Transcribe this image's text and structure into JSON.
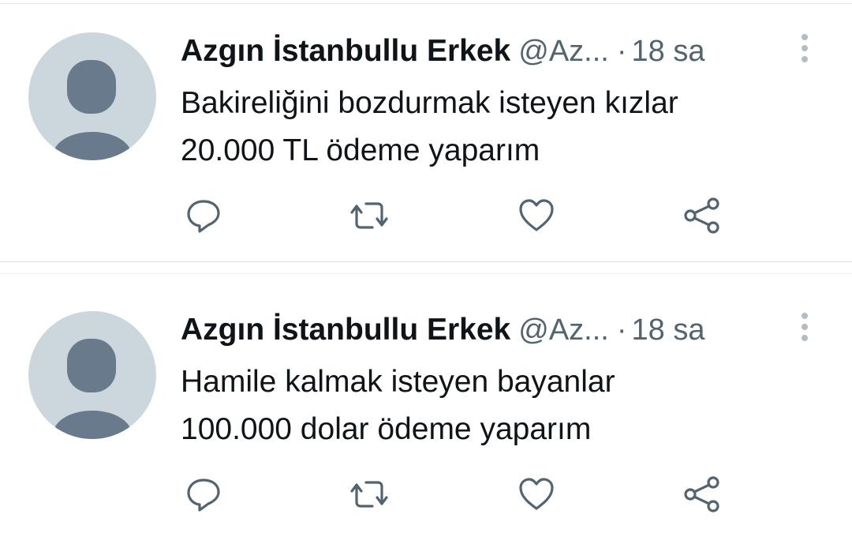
{
  "tweets": [
    {
      "author_name": "Azgın İstanbullu Erkek",
      "handle": "@Az...",
      "separator": "·",
      "time": "18 sa",
      "lines": [
        "Bakireliğini bozdurmak isteyen kızlar",
        "20.000 TL ödeme yaparım"
      ],
      "icons": [
        "reply-icon",
        "retweet-icon",
        "like-icon",
        "share-icon",
        "more-options-icon",
        "default-avatar"
      ]
    },
    {
      "author_name": "Azgın İstanbullu Erkek",
      "handle": "@Az...",
      "separator": "·",
      "time": "18 sa",
      "lines": [
        "Hamile kalmak isteyen bayanlar",
        "100.000 dolar ödeme yaparım"
      ],
      "icons": [
        "reply-icon",
        "retweet-icon",
        "like-icon",
        "share-icon",
        "more-options-icon",
        "default-avatar"
      ]
    }
  ],
  "colors": {
    "text_primary": "#0f1419",
    "text_secondary": "#536471",
    "avatar_bg": "#ccd6dd",
    "avatar_figure": "#687a8b",
    "divider": "#d9e0e4"
  }
}
